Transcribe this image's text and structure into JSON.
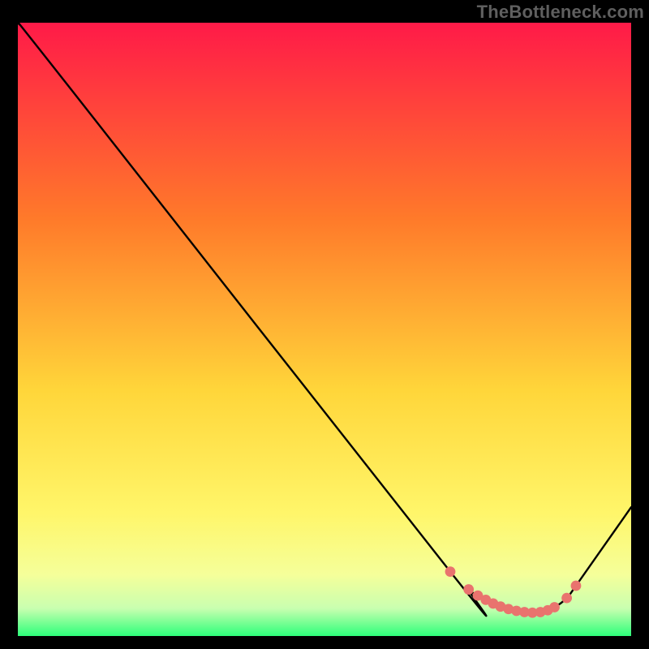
{
  "watermark": "TheBottleneck.com",
  "colors": {
    "black": "#000000",
    "grad_top": "#ff1a48",
    "grad_mid1": "#ff7a2a",
    "grad_mid2": "#ffd63a",
    "grad_low1": "#fff66a",
    "grad_low2": "#f5ff9a",
    "grad_low3": "#c9ffb0",
    "grad_bottom": "#2dff7a",
    "line": "#000000",
    "marker_fill": "#e9736e",
    "marker_stroke": "#e9736e"
  },
  "chart_data": {
    "type": "line",
    "title": "",
    "xlabel": "",
    "ylabel": "",
    "xlim": [
      0,
      100
    ],
    "ylim": [
      0,
      100
    ],
    "series": [
      {
        "name": "curve",
        "x": [
          0,
          8,
          70.5,
          73.5,
          76,
          79,
          82,
          85,
          87.5,
          89.5,
          91,
          100
        ],
        "y": [
          100,
          90,
          10.5,
          7.6,
          5.8,
          4.4,
          3.8,
          3.9,
          4.7,
          6.2,
          8.2,
          21
        ]
      }
    ],
    "markers": {
      "name": "highlight-points",
      "x": [
        70.5,
        73.5,
        75.0,
        76.3,
        77.5,
        78.7,
        80.0,
        81.3,
        82.6,
        83.9,
        85.2,
        86.4,
        87.5,
        89.5,
        91.0
      ],
      "y": [
        10.5,
        7.6,
        6.6,
        5.9,
        5.3,
        4.8,
        4.4,
        4.1,
        3.9,
        3.8,
        3.9,
        4.2,
        4.7,
        6.2,
        8.2
      ]
    }
  }
}
